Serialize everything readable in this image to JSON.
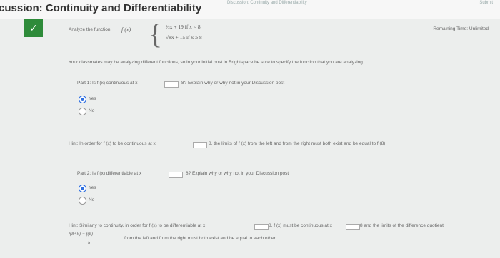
{
  "header": {
    "title": "cussion: Continuity and Differentiability",
    "mini_left": "Discussion: Continuity and Differentiability",
    "mini_right": "Submit"
  },
  "question": {
    "analyze_label": "Analyze the function",
    "func": "f (x)",
    "piece1": "½x + 19   if x < 8",
    "piece2": "√8x + 15  if x ≥ 8",
    "remaining": "Remaining Time: Unlimited",
    "classmates_note": "Your classmates may be analyzing different functions, so in your initial post in Brightspace be sure to specify the function that you are analyzing.",
    "part1": "Part 1: Is f (x) continuous at x",
    "part1_tail": "8? Explain why or why not in your Discussion post",
    "part1_options": [
      "Yes",
      "No"
    ],
    "hint1_a": "Hint: In order for f (x) to be continuous at x",
    "hint1_b": "8, the limits of f (x) from the left and from the right must both exist and be equal to f (8)",
    "part2": "Part 2: Is f (x) differentiable at x",
    "part2_tail": "8? Explain why or why not in your Discussion post",
    "part2_options": [
      "Yes",
      "No"
    ],
    "hint2_a": "Hint: Similarly to continuity, in order for f (x) to be differentiable at x",
    "hint2_b": "8, f (x) must be continuous at x",
    "hint2_c": "8 and the limits of the difference quotient",
    "hint2_frac_num": "f(8+h) − f(8)",
    "hint2_frac_den": "h",
    "hint2_d": "from the left and from the right must both exist and be equal to each other"
  }
}
